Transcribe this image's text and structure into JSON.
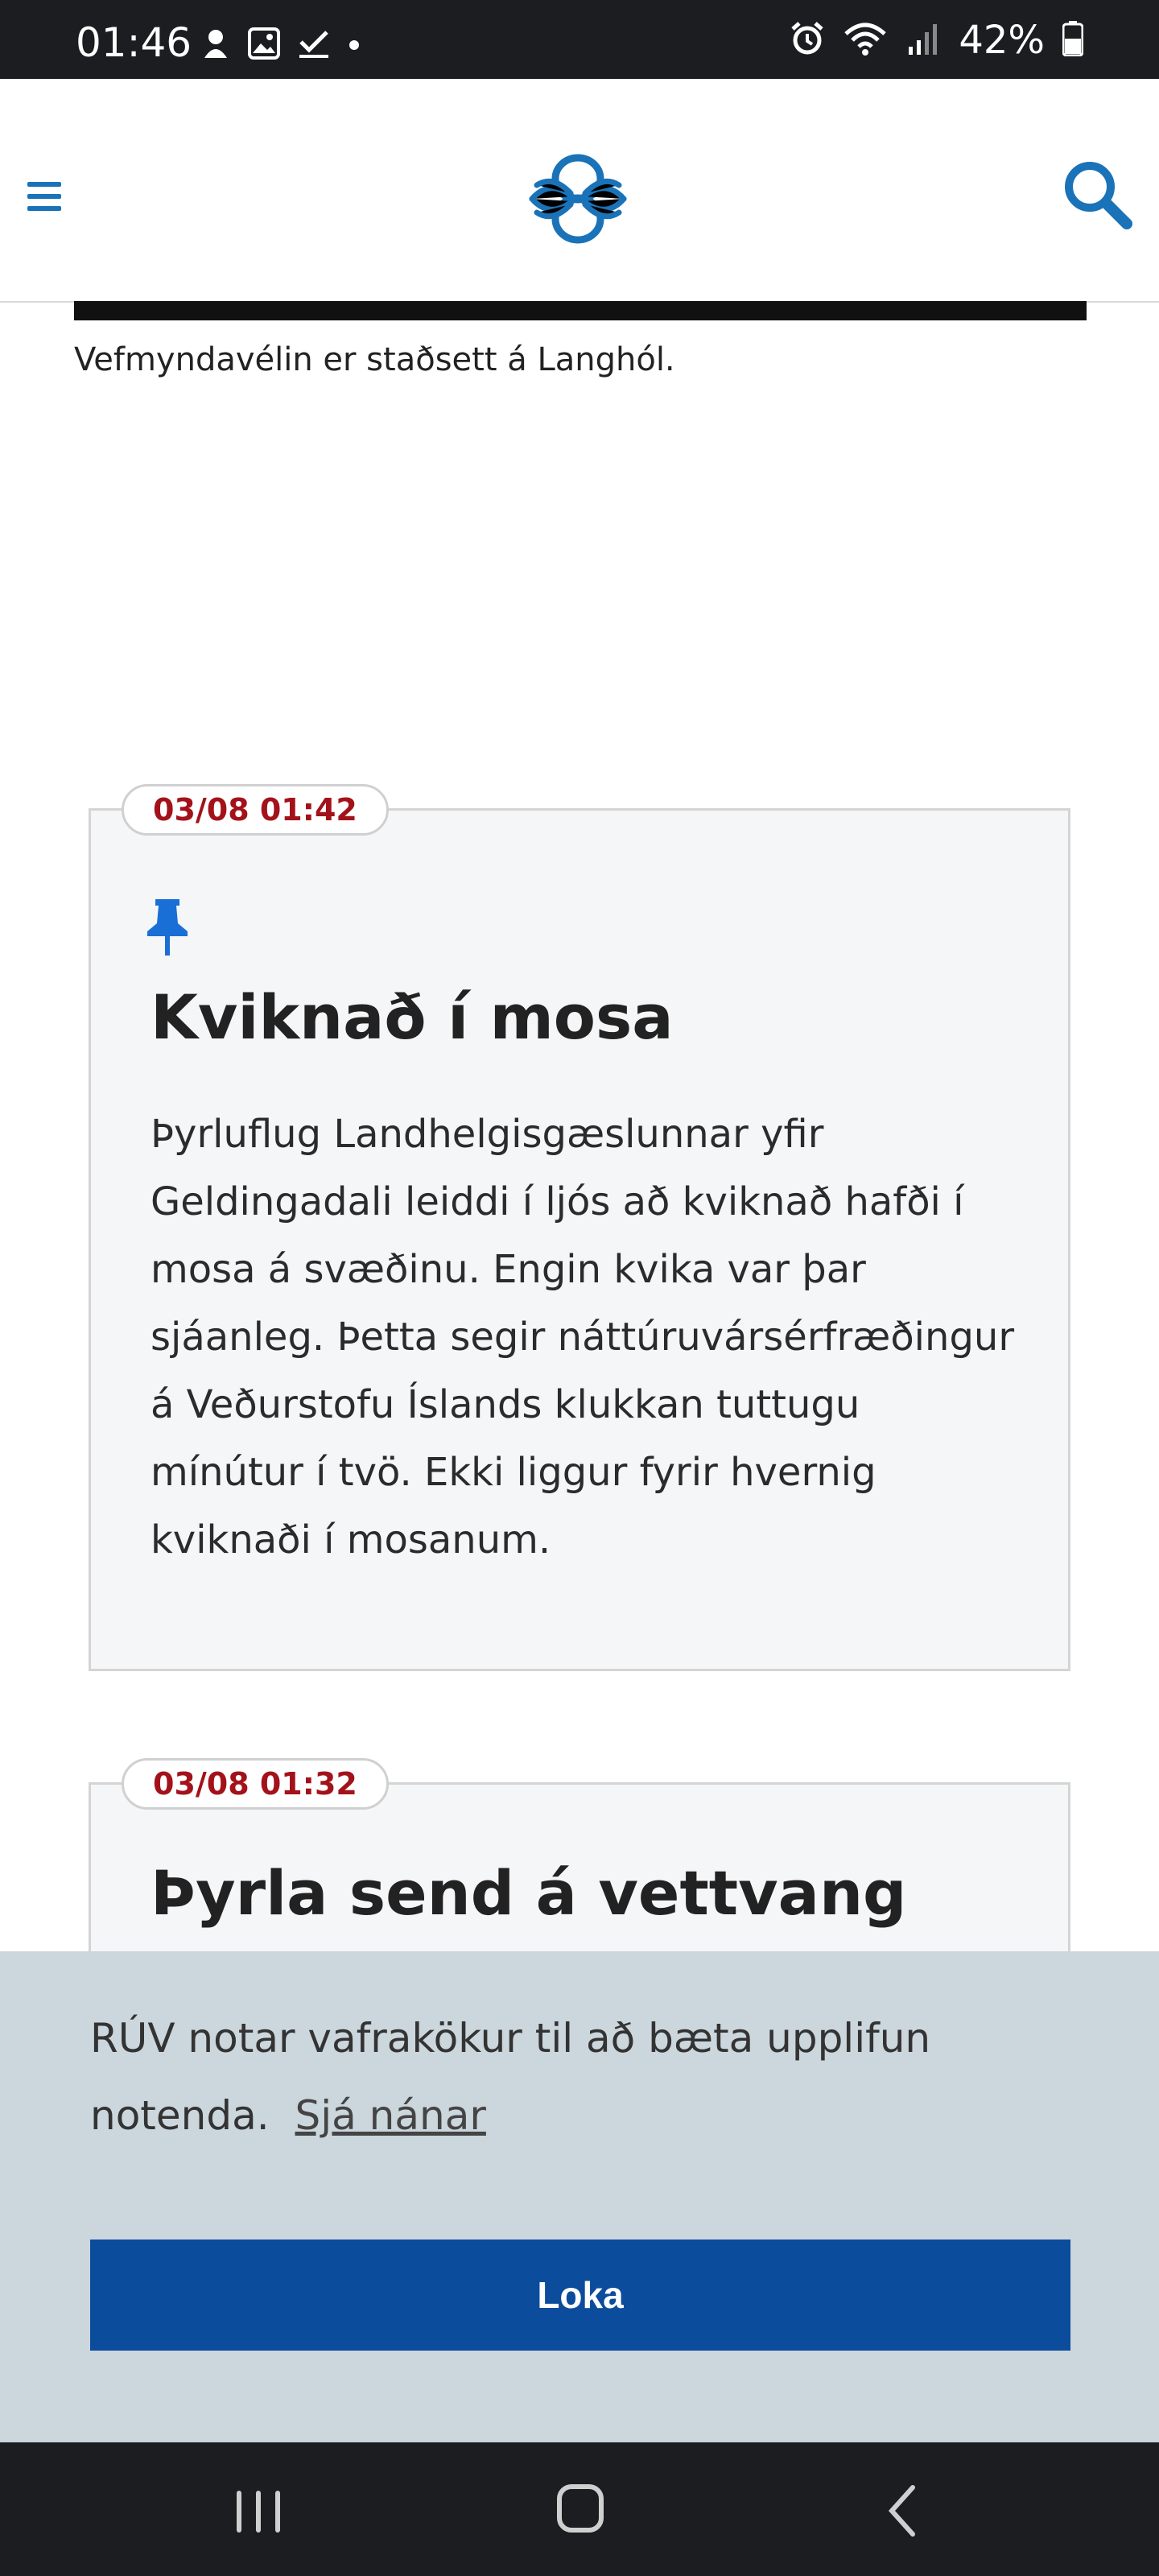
{
  "status_bar": {
    "time": "01:46",
    "left_icons": [
      "notification-icon",
      "gallery-icon",
      "check-icon",
      "dot-icon"
    ],
    "right_icons": [
      "alarm-icon",
      "wifi-icon",
      "signal-icon",
      "battery-icon"
    ],
    "battery": "42%"
  },
  "header": {
    "menu_icon": "hamburger-menu-icon",
    "logo": "ruv-logo",
    "search_icon": "search-icon",
    "accent_color": "#1a73b8"
  },
  "caption": "Vefmyndavélin er staðsett á Langhól.",
  "entries": [
    {
      "time": "03/08 01:42",
      "pinned": true,
      "title": "Kviknað í mosa",
      "body": "Þyrluflug Landhelgisgæslunnar yfir Geldingadali leiddi í ljós að kviknað hafði í mosa á svæðinu. Engin kvika var þar sjáanleg. Þetta segir náttúruvársérfræðingur á Veðurstofu Íslands klukkan tuttugu mínútur í tvö. Ekki liggur fyrir hvernig kviknaði í mosanum."
    },
    {
      "time": "03/08 01:32",
      "pinned": false,
      "title": "Þyrla send á vettvang"
    }
  ],
  "cookie_banner": {
    "text": "RÚV notar vafrakökur til að bæta upplifun notenda.",
    "link": "Sjá nánar",
    "button": "Loka",
    "button_color": "#0b4c9c",
    "background": "#ccd6dd"
  },
  "nav_bar": {
    "recent_icon": "recent-apps-icon",
    "home_icon": "home-icon",
    "back_icon": "back-icon"
  },
  "colors": {
    "timestamp": "#a3121a",
    "pin": "#1a6fd6"
  }
}
